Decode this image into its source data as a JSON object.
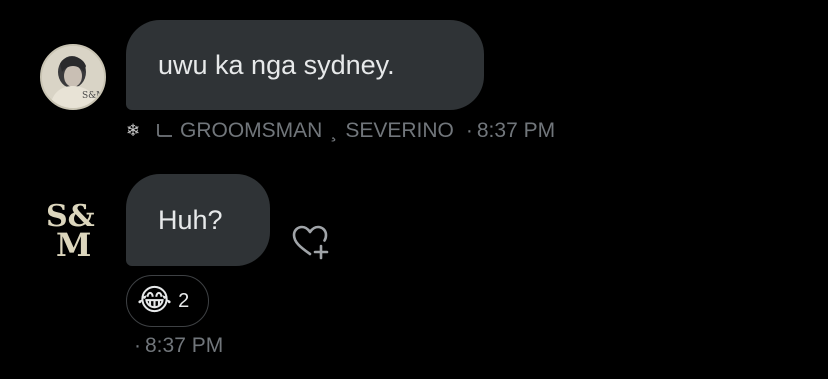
{
  "messages": [
    {
      "text": "uwu ka nga sydney.",
      "sender_prefix_icon": "snowflake-icon",
      "sender_name": "GROOMSMAN",
      "sender_separator": "¸",
      "sender_surname": "SEVERINO",
      "dot": "·",
      "time": "8:37 PM"
    },
    {
      "text": "Huh?",
      "reactions": [
        {
          "emoji": "😂",
          "emoji_name": "tears-of-joy-emoji",
          "count": "2"
        }
      ],
      "dot": "·",
      "time": "8:37 PM"
    }
  ],
  "avatar_logo": {
    "line1": "S&",
    "line2": "M"
  },
  "avatar_badge": "S&M",
  "colors": {
    "background": "#000000",
    "bubble": "#2f3336",
    "text": "#e7e9ea",
    "muted": "#71767b",
    "logo": "#dcd6bd"
  }
}
